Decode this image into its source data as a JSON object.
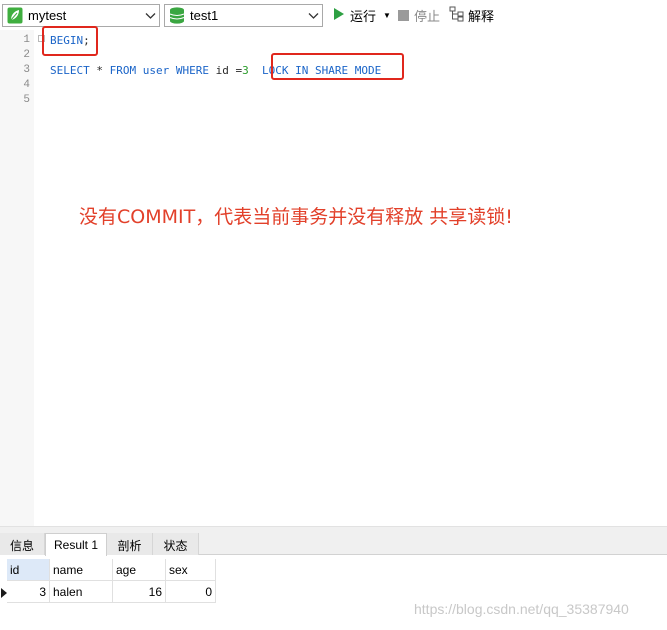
{
  "toolbar": {
    "connection": "mytest",
    "database": "test1",
    "run_label": "运行",
    "stop_label": "停止",
    "explain_label": "解释",
    "icons": {
      "connection": "connection-leaf-icon",
      "database": "database-cylinder-icon",
      "run": "play-icon",
      "stop": "stop-icon",
      "explain": "explain-icon"
    },
    "colors": {
      "connection_icon": "#3fae3f",
      "database_icon": "#3aa641",
      "run_icon": "#2ea043"
    }
  },
  "editor": {
    "line_numbers": [
      "1",
      "2",
      "3",
      "4",
      "5"
    ],
    "line1": {
      "keyword": "BEGIN",
      "punct": ";"
    },
    "line3": {
      "select": "SELECT",
      "star": " * ",
      "from": "FROM",
      "table": " user ",
      "where": "WHERE",
      "col": " id =",
      "num": "3",
      "lock": "LOCK IN SHARE MODE"
    },
    "annotation": "没有COMMIT，代表当前事务并没有释放 共享读锁!",
    "colors": {
      "keyword": "#1a64c8",
      "annotation": "#e2402a",
      "highlight_box": "#e0271d"
    }
  },
  "results": {
    "tabs": [
      "信息",
      "Result 1",
      "剖析",
      "状态"
    ],
    "active_tab": "Result 1",
    "columns": [
      "id",
      "name",
      "age",
      "sex"
    ],
    "rows": [
      {
        "id": "3",
        "name": "halen",
        "age": "16",
        "sex": "0"
      }
    ]
  },
  "watermark": "https://blog.csdn.net/qq_35387940"
}
